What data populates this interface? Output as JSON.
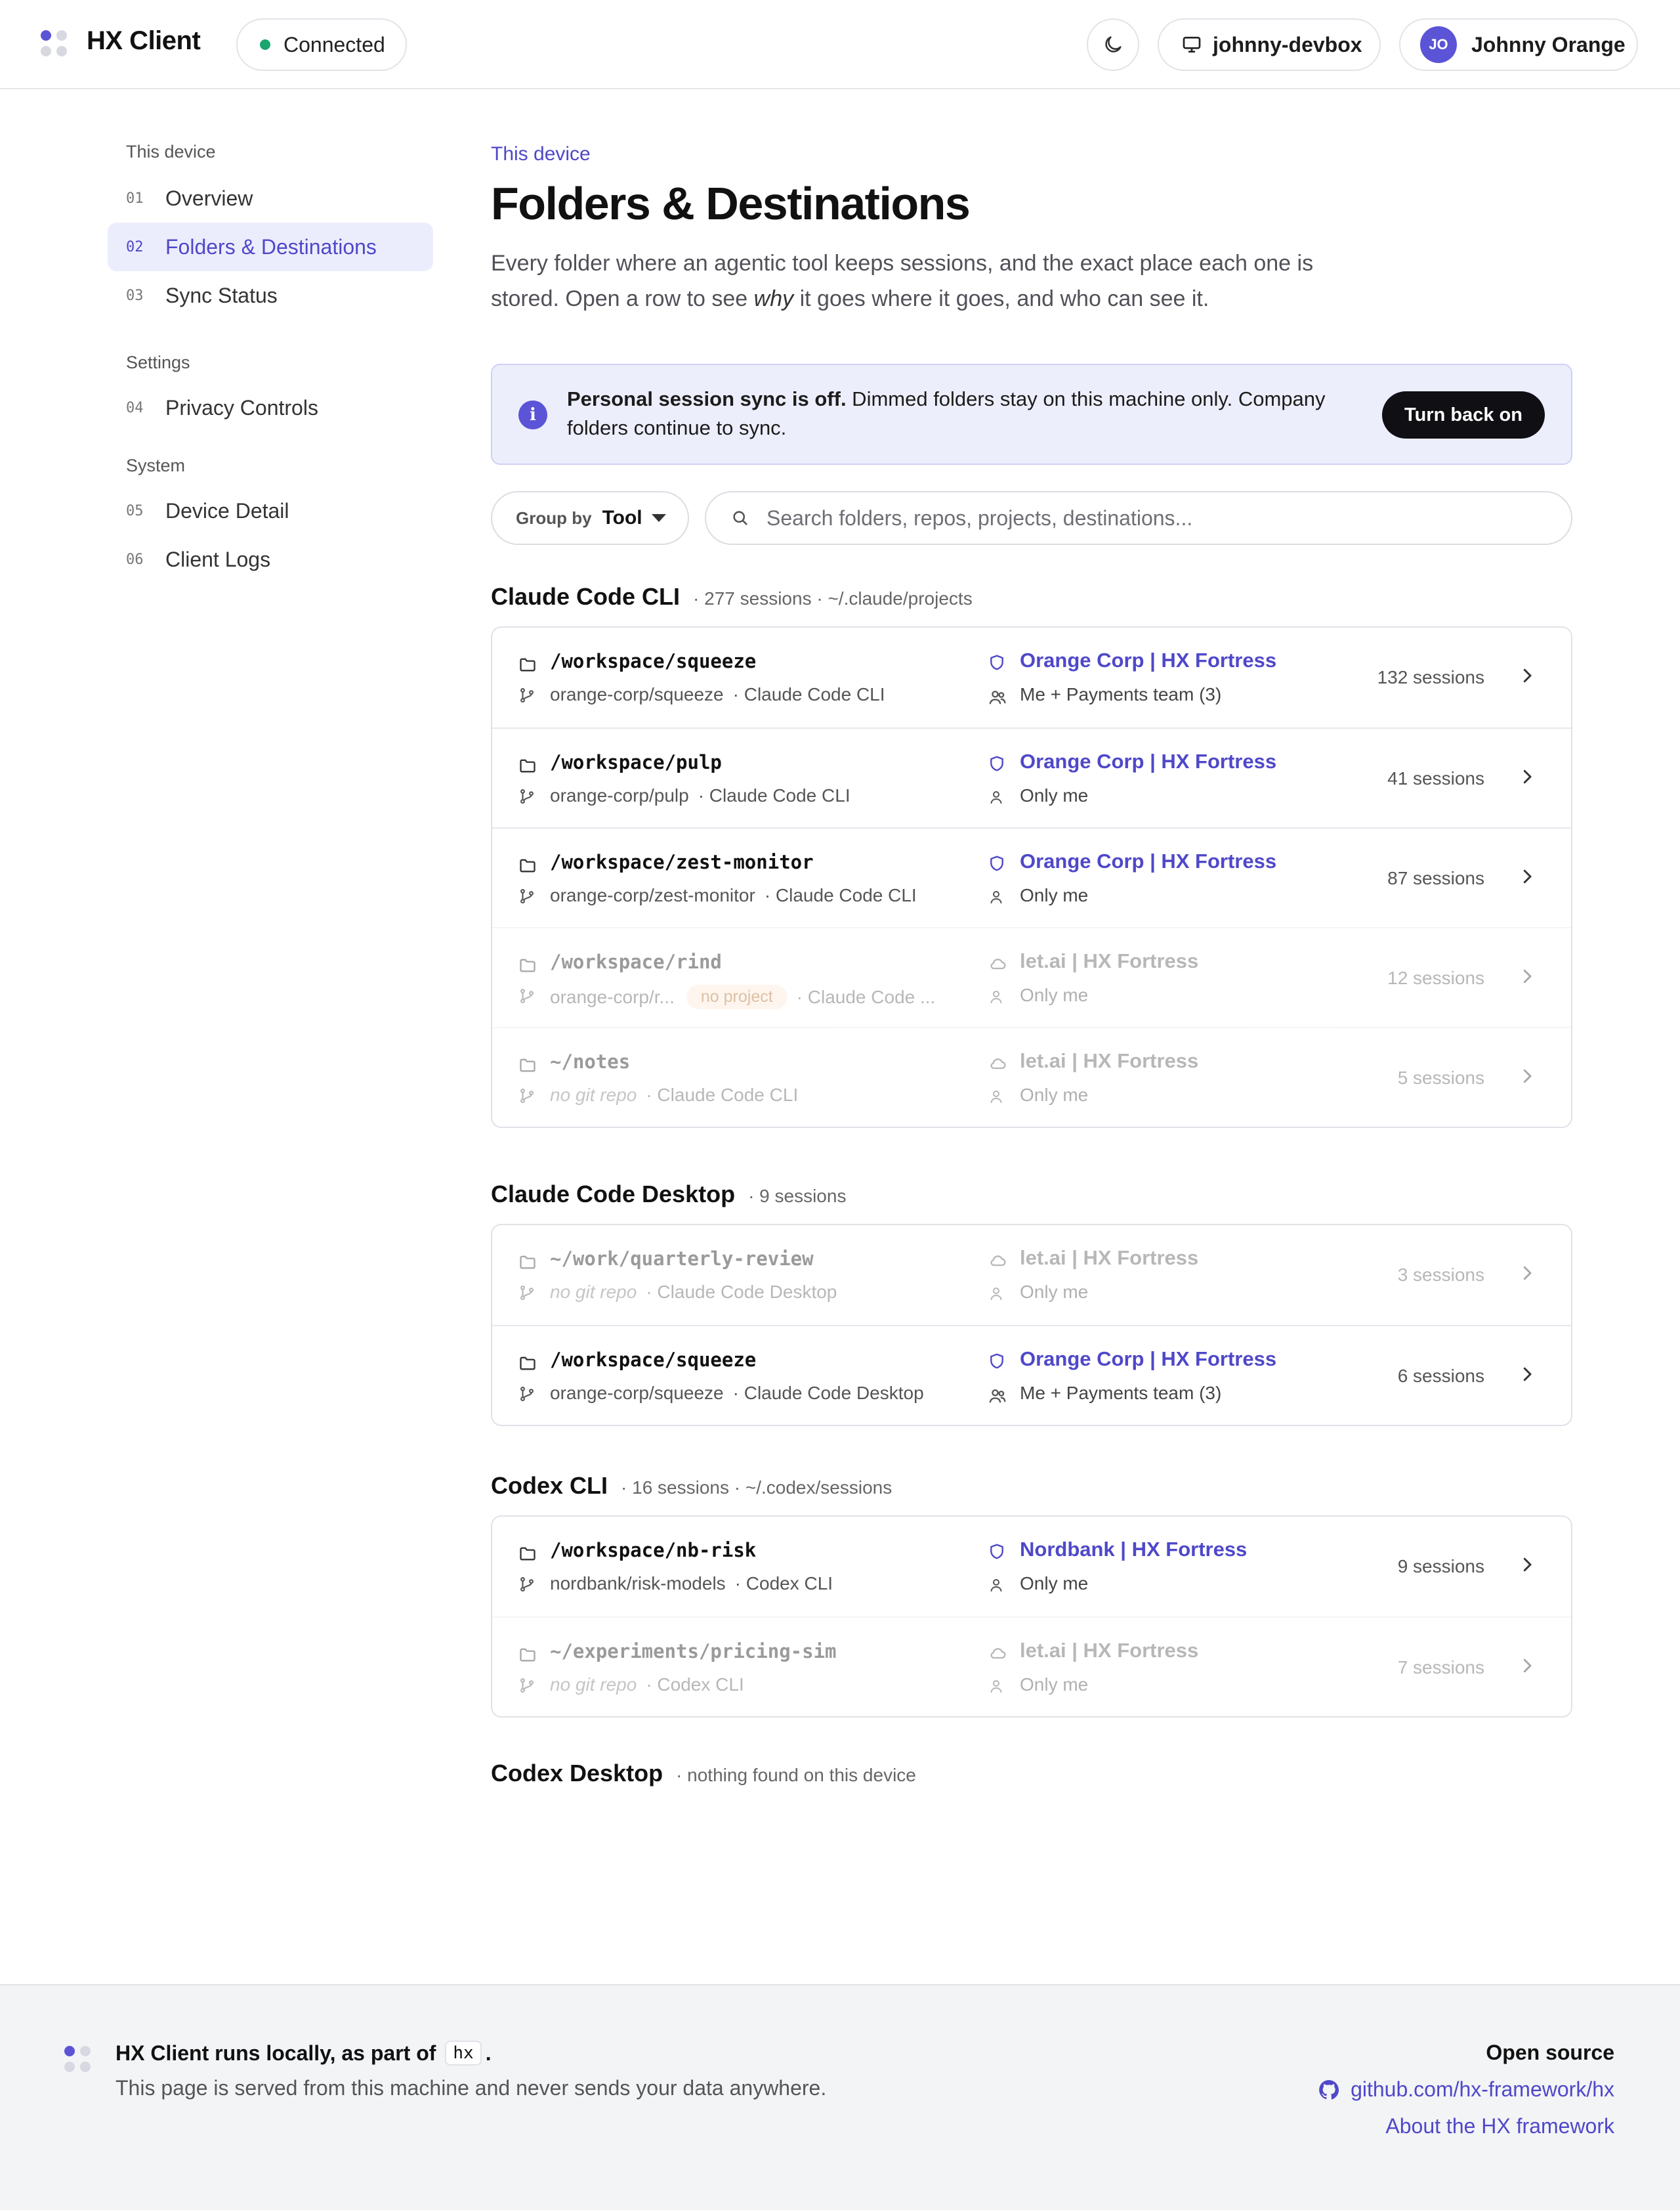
{
  "header": {
    "app_title": "HX Client",
    "connection_status": "Connected",
    "device_name": "johnny-devbox",
    "user_initials": "JO",
    "user_name": "Johnny Orange"
  },
  "sidebar": {
    "sections": [
      {
        "title": "This device",
        "items": [
          {
            "num": "01",
            "label": "Overview"
          },
          {
            "num": "02",
            "label": "Folders & Destinations",
            "active": true
          },
          {
            "num": "03",
            "label": "Sync Status"
          }
        ]
      },
      {
        "title": "Settings",
        "items": [
          {
            "num": "04",
            "label": "Privacy Controls"
          }
        ]
      },
      {
        "title": "System",
        "items": [
          {
            "num": "05",
            "label": "Device Detail"
          },
          {
            "num": "06",
            "label": "Client Logs"
          }
        ]
      }
    ]
  },
  "main": {
    "eyebrow": "This device",
    "title": "Folders & Destinations",
    "intro_before": "Every folder where an agentic tool keeps sessions, and the exact place each one is stored. Open a row to see ",
    "intro_em": "why",
    "intro_after": " it goes where it goes, and who can see it."
  },
  "banner": {
    "bold": "Personal session sync is off.",
    "text": " Dimmed folders stay on this machine only. Company folders continue to sync.",
    "button": "Turn back on"
  },
  "filters": {
    "group_by_label": "Group by",
    "group_by_value": "Tool",
    "search_placeholder": "Search folders, repos, projects, destinations..."
  },
  "groups": [
    {
      "name": "Claude Code CLI",
      "meta": "· 277 sessions · ~/.claude/projects",
      "rows": [
        {
          "path": "/workspace/squeeze",
          "repo": "orange-corp/squeeze",
          "tool": "· Claude Code CLI",
          "dest": "Orange Corp | HX Fortress",
          "audience": "Me + Payments team (3)",
          "count": "132 sessions"
        },
        {
          "path": "/workspace/pulp",
          "repo": "orange-corp/pulp",
          "tool": "· Claude Code CLI",
          "dest": "Orange Corp | HX Fortress",
          "audience": "Only me",
          "count": "41 sessions"
        },
        {
          "path": "/workspace/zest-monitor",
          "repo": "orange-corp/zest-monitor",
          "tool": "· Claude Code CLI",
          "dest": "Orange Corp | HX Fortress",
          "audience": "Only me",
          "count": "87 sessions"
        },
        {
          "path": "/workspace/rind",
          "repo": "orange-corp/r...",
          "tag": "no project",
          "tool": "· Claude Code ...",
          "dest": "let.ai | HX Fortress",
          "audience": "Only me",
          "count": "12 sessions",
          "dim": true
        },
        {
          "path": "~/notes",
          "repo": "no git repo",
          "tool": "· Claude Code CLI",
          "dest": "let.ai | HX Fortress",
          "audience": "Only me",
          "count": "5 sessions",
          "dim": true
        }
      ]
    },
    {
      "name": "Claude Code Desktop",
      "meta": "· 9 sessions",
      "rows": [
        {
          "path": "~/work/quarterly-review",
          "repo": "no git repo",
          "tool": "· Claude Code Desktop",
          "dest": "let.ai | HX Fortress",
          "audience": "Only me",
          "count": "3 sessions",
          "dim": true
        },
        {
          "path": "/workspace/squeeze",
          "repo": "orange-corp/squeeze",
          "tool": "· Claude Code Desktop",
          "dest": "Orange Corp | HX Fortress",
          "audience": "Me + Payments team (3)",
          "count": "6 sessions"
        }
      ]
    },
    {
      "name": "Codex CLI",
      "meta": "· 16 sessions · ~/.codex/sessions",
      "rows": [
        {
          "path": "/workspace/nb-risk",
          "repo": "nordbank/risk-models",
          "tool": "· Codex CLI",
          "dest": "Nordbank | HX Fortress",
          "audience": "Only me",
          "count": "9 sessions"
        },
        {
          "path": "~/experiments/pricing-sim",
          "repo": "no git repo",
          "tool": "· Codex CLI",
          "dest": "let.ai | HX Fortress",
          "audience": "Only me",
          "count": "7 sessions",
          "dim": true
        }
      ]
    },
    {
      "name": "Codex Desktop",
      "meta": "· nothing found on this device",
      "rows": []
    }
  ],
  "footer": {
    "title": "HX Client runs locally, as part of",
    "code": "hx",
    "title_end": ".",
    "subtitle": "This page is served from this machine and never sends your data anywhere.",
    "open_source": "Open source",
    "github": "github.com/hx-framework/hx",
    "about": "About the HX framework"
  },
  "colors": {
    "accent": "#4f48c9",
    "connected": "#1aa56f",
    "tag_bg": "#fde9d8",
    "tag_text": "#b06a2a"
  }
}
